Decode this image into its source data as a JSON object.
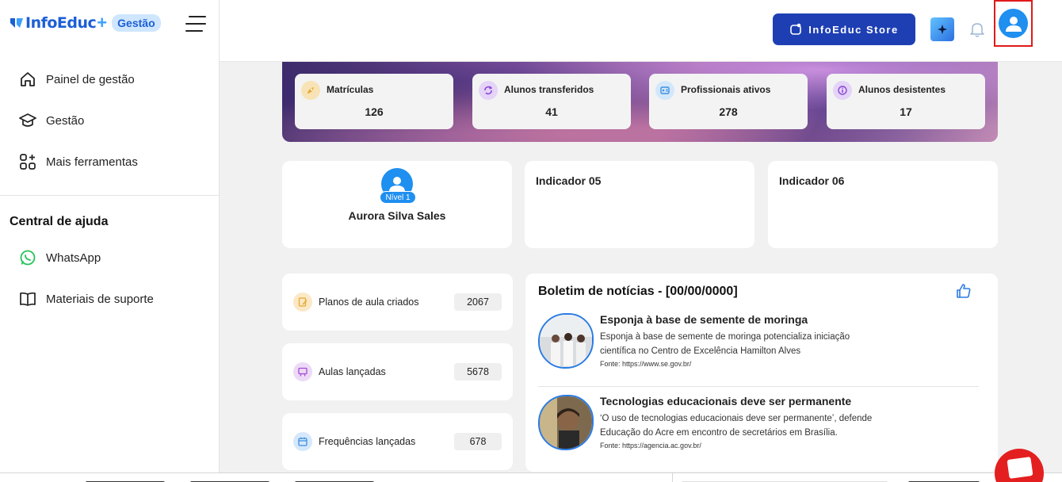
{
  "brand": {
    "name": "InfoEduc",
    "plus": "+",
    "badge": "Gestão"
  },
  "sidebar": {
    "items": [
      {
        "label": "Painel de gestão",
        "icon": "home-icon"
      },
      {
        "label": "Gestão",
        "icon": "graduation-cap-icon"
      },
      {
        "label": "Mais ferramentas",
        "icon": "grid-plus-icon"
      }
    ],
    "help_title": "Central de ajuda",
    "help_items": [
      {
        "label": "WhatsApp",
        "icon": "whatsapp-icon"
      },
      {
        "label": "Materiais de suporte",
        "icon": "book-icon"
      }
    ]
  },
  "header": {
    "store_label": "InfoEduc Store",
    "colors": {
      "store": "#1e3fb4",
      "avatar": "#1f8ff0",
      "highlight": "#e01a1a"
    }
  },
  "stats": [
    {
      "label": "Matrículas",
      "value": "126",
      "icon": "rocket-icon",
      "color": "#f7e3b5"
    },
    {
      "label": "Alunos transferidos",
      "value": "41",
      "icon": "refresh-icon",
      "color": "#e4d4f7"
    },
    {
      "label": "Profissionais ativos",
      "value": "278",
      "icon": "id-card-icon",
      "color": "#d3e7fb"
    },
    {
      "label": "Alunos desistentes",
      "value": "17",
      "icon": "info-icon",
      "color": "#e4d4f7"
    }
  ],
  "profile": {
    "level": "Nível 1",
    "name": "Aurora Silva Sales"
  },
  "indicators": [
    "Indicador 05",
    "Indicador 06"
  ],
  "metrics": [
    {
      "label": "Planos de aula criados",
      "value": "2067",
      "icon": "document-pen-icon",
      "color": "#fbe8c6"
    },
    {
      "label": "Aulas lançadas",
      "value": "5678",
      "icon": "presentation-icon",
      "color": "#ecdaf7"
    },
    {
      "label": "Frequências lançadas",
      "value": "678",
      "icon": "calendar-icon",
      "color": "#d6e8fb"
    }
  ],
  "news": {
    "title": "Boletim de notícias - [00/00/0000]",
    "items": [
      {
        "headline": "Esponja à base de semente de moringa",
        "body": "Esponja à base de semente de moringa potencializa iniciação científica no Centro de Excelência Hamilton Alves",
        "source": "Fonte: https://www.se.gov.br/"
      },
      {
        "headline": "Tecnologias educacionais deve ser permanente",
        "body": "‘O uso de tecnologias educacionais deve ser permanente’, defende Educação do Acre em encontro de secretários em Brasília.",
        "source": "Fonte: https://agencia.ac.gov.br/"
      }
    ]
  }
}
